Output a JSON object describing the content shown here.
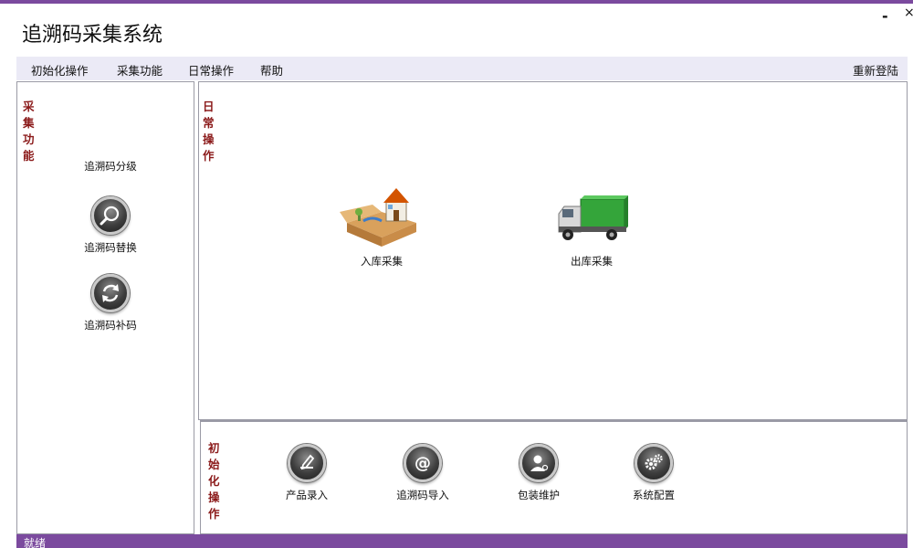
{
  "window": {
    "title": "追溯码采集系统",
    "minimize_label": "-",
    "close_label": "×"
  },
  "menu": {
    "items": [
      "初始化操作",
      "采集功能",
      "日常操作",
      "帮助"
    ],
    "relogin": "重新登陆"
  },
  "left_panel": {
    "section_label": "采集功能",
    "tools": [
      {
        "label": "追溯码分级",
        "icon": "grade-icon"
      },
      {
        "label": "追溯码替换",
        "icon": "search-icon"
      },
      {
        "label": "追溯码补码",
        "icon": "refresh-icon"
      }
    ]
  },
  "main_panel": {
    "section_label": "日常操作",
    "tools": [
      {
        "label": "入库采集",
        "icon": "warehouse-house-icon"
      },
      {
        "label": "出库采集",
        "icon": "delivery-truck-icon"
      }
    ]
  },
  "bottom_panel": {
    "section_label": "初始化操作",
    "tools": [
      {
        "label": "产品录入",
        "icon": "pencil-icon"
      },
      {
        "label": "追溯码导入",
        "icon": "at-icon"
      },
      {
        "label": "包装维护",
        "icon": "user-icon"
      },
      {
        "label": "系统配置",
        "icon": "gears-icon"
      }
    ]
  },
  "statusbar": {
    "text": "就绪"
  },
  "colors": {
    "accent": "#7b4a9e",
    "menu_bg": "#ebeaf6",
    "section_label": "#8b1a1a"
  }
}
